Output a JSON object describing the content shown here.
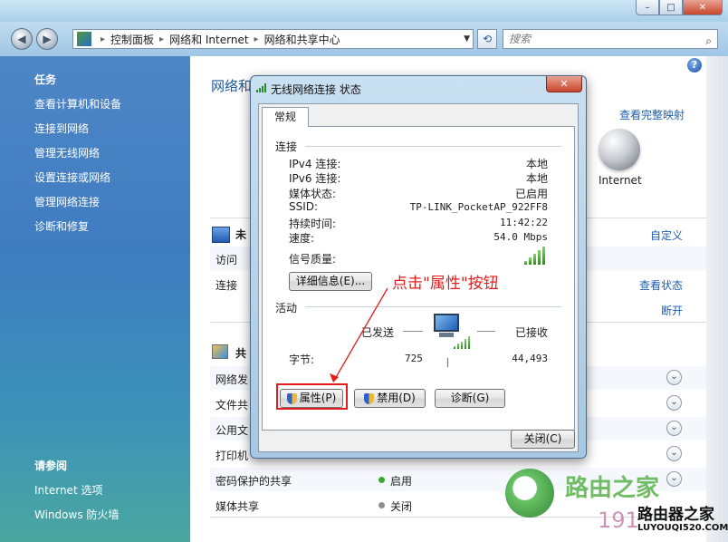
{
  "window": {
    "min": "–",
    "max": "□",
    "close": "✕"
  },
  "nav": {
    "back": "◀",
    "forward": "▶",
    "breadcrumb": [
      "控制面板",
      "网络和 Internet",
      "网络和共享中心"
    ],
    "separator": "▸",
    "search_placeholder": "搜索",
    "refresh": "⟲",
    "search_glyph": "⌕",
    "dropdown_glyph": "▼"
  },
  "sidebar": {
    "tasks_heading": "任务",
    "tasks": [
      "查看计算机和设备",
      "连接到网络",
      "管理无线网络",
      "设置连接或网络",
      "管理网络连接",
      "诊断和修复"
    ],
    "see_also_heading": "请参阅",
    "see_also": [
      "Internet 选项",
      "Windows 防火墙"
    ]
  },
  "main": {
    "title": "网络和",
    "help": "?",
    "view_full_map": "查看完整映射",
    "internet_label": "Internet",
    "network_name": "未",
    "customize": "自定义",
    "access_label": "访问",
    "connection_label": "连接",
    "view_status": "查看状态",
    "disconnect": "断开",
    "sharing_heading": "共",
    "sharing_rows": [
      {
        "label": "网络发",
        "status": "",
        "dot": ""
      },
      {
        "label": "文件共",
        "status": "",
        "dot": ""
      },
      {
        "label": "公用文",
        "status": "",
        "dot": ""
      },
      {
        "label": "打印机",
        "status": "",
        "dot": ""
      },
      {
        "label": "密码保护的共享",
        "status": "启用",
        "dot": "#3aa832"
      },
      {
        "label": "媒体共享",
        "status": "关闭",
        "dot": "#8f8f8f"
      }
    ],
    "chevron": "⌄"
  },
  "dialog": {
    "title": "无线网络连接 状态",
    "close": "✕",
    "tab": "常规",
    "connection_group": "连接",
    "fields": [
      {
        "key": "IPv4 连接:",
        "value": "本地"
      },
      {
        "key": "IPv6 连接:",
        "value": "本地"
      },
      {
        "key": "媒体状态:",
        "value": "已启用"
      },
      {
        "key": "SSID:",
        "value": "TP-LINK_PocketAP_922FF8"
      },
      {
        "key": "持续时间:",
        "value": "11:42:22"
      },
      {
        "key": "速度:",
        "value": "54.0 Mbps"
      }
    ],
    "signal_label": "信号质量:",
    "signal_bars": 5,
    "signal_max": 5,
    "details_button": "详细信息(E)...",
    "activity_group": "活动",
    "sent_label": "已发送",
    "received_label": "已接收",
    "bytes_label": "字节:",
    "bytes_sent": "725",
    "bytes_received": "44,493",
    "properties_button": "属性(P)",
    "disable_button": "禁用(D)",
    "diagnose_button": "诊断(G)",
    "close_button": "关闭(C)"
  },
  "annotation": {
    "text": "点击\"属性\"按钮",
    "color": "#e21d1d"
  },
  "watermark": {
    "text": "路由之家",
    "number": "191",
    "brand": "路由器之家",
    "url": "LUYOUQI520.COM"
  }
}
